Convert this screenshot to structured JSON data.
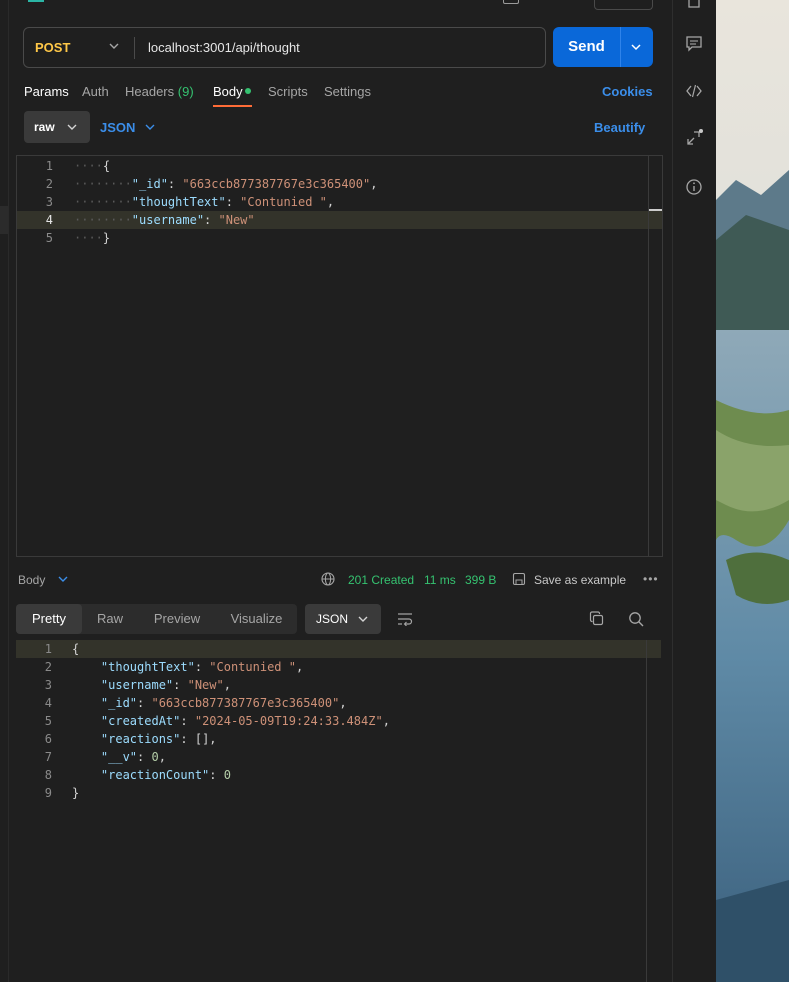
{
  "request": {
    "method": "POST",
    "url": "localhost:3001/api/thought",
    "send_label": "Send"
  },
  "request_tabs": {
    "params": "Params",
    "auth": "Auth",
    "headers": "Headers",
    "headers_count": "(9)",
    "body": "Body",
    "scripts": "Scripts",
    "settings": "Settings",
    "cookies": "Cookies"
  },
  "body_options": {
    "mode": "raw",
    "language": "JSON",
    "beautify": "Beautify"
  },
  "request_body": {
    "lines": [
      {
        "n": "1",
        "ws": "····",
        "text": [
          {
            "t": "{",
            "c": "punc"
          }
        ]
      },
      {
        "n": "2",
        "ws": "········",
        "text": [
          {
            "t": "\"_id\"",
            "c": "key"
          },
          {
            "t": ": ",
            "c": "punc"
          },
          {
            "t": "\"663ccb877387767e3c365400\"",
            "c": "str"
          },
          {
            "t": ",",
            "c": "punc"
          }
        ]
      },
      {
        "n": "3",
        "ws": "········",
        "text": [
          {
            "t": "\"thoughtText\"",
            "c": "key"
          },
          {
            "t": ": ",
            "c": "punc"
          },
          {
            "t": "\"Contunied \"",
            "c": "str"
          },
          {
            "t": ",",
            "c": "punc"
          }
        ]
      },
      {
        "n": "4",
        "ws": "········",
        "text": [
          {
            "t": "\"username\"",
            "c": "key"
          },
          {
            "t": ": ",
            "c": "punc"
          },
          {
            "t": "\"New\"",
            "c": "str"
          }
        ]
      },
      {
        "n": "5",
        "ws": "····",
        "text": [
          {
            "t": "}",
            "c": "punc"
          }
        ]
      }
    ]
  },
  "response_meta": {
    "body_label": "Body",
    "status": "201 Created",
    "time": "11 ms",
    "size": "399 B",
    "save_example": "Save as example",
    "more": "•••"
  },
  "response_tabs": {
    "pretty": "Pretty",
    "raw": "Raw",
    "preview": "Preview",
    "visualize": "Visualize",
    "format": "JSON"
  },
  "response_body": {
    "lines": [
      {
        "n": "1",
        "text": [
          {
            "t": "{",
            "c": "punc"
          }
        ]
      },
      {
        "n": "2",
        "text": [
          {
            "t": "    ",
            "c": "punc"
          },
          {
            "t": "\"thoughtText\"",
            "c": "key"
          },
          {
            "t": ": ",
            "c": "punc"
          },
          {
            "t": "\"Contunied \"",
            "c": "str"
          },
          {
            "t": ",",
            "c": "punc"
          }
        ]
      },
      {
        "n": "3",
        "text": [
          {
            "t": "    ",
            "c": "punc"
          },
          {
            "t": "\"username\"",
            "c": "key"
          },
          {
            "t": ": ",
            "c": "punc"
          },
          {
            "t": "\"New\"",
            "c": "str"
          },
          {
            "t": ",",
            "c": "punc"
          }
        ]
      },
      {
        "n": "4",
        "text": [
          {
            "t": "    ",
            "c": "punc"
          },
          {
            "t": "\"_id\"",
            "c": "key"
          },
          {
            "t": ": ",
            "c": "punc"
          },
          {
            "t": "\"663ccb877387767e3c365400\"",
            "c": "str"
          },
          {
            "t": ",",
            "c": "punc"
          }
        ]
      },
      {
        "n": "5",
        "text": [
          {
            "t": "    ",
            "c": "punc"
          },
          {
            "t": "\"createdAt\"",
            "c": "key"
          },
          {
            "t": ": ",
            "c": "punc"
          },
          {
            "t": "\"2024-05-09T19:24:33.484Z\"",
            "c": "str"
          },
          {
            "t": ",",
            "c": "punc"
          }
        ]
      },
      {
        "n": "6",
        "text": [
          {
            "t": "    ",
            "c": "punc"
          },
          {
            "t": "\"reactions\"",
            "c": "key"
          },
          {
            "t": ": [],",
            "c": "punc"
          }
        ]
      },
      {
        "n": "7",
        "text": [
          {
            "t": "    ",
            "c": "punc"
          },
          {
            "t": "\"__v\"",
            "c": "key"
          },
          {
            "t": ": ",
            "c": "punc"
          },
          {
            "t": "0",
            "c": "num"
          },
          {
            "t": ",",
            "c": "punc"
          }
        ]
      },
      {
        "n": "8",
        "text": [
          {
            "t": "    ",
            "c": "punc"
          },
          {
            "t": "\"reactionCount\"",
            "c": "key"
          },
          {
            "t": ": ",
            "c": "punc"
          },
          {
            "t": "0",
            "c": "num"
          }
        ]
      },
      {
        "n": "9",
        "text": [
          {
            "t": "}",
            "c": "punc"
          }
        ]
      }
    ]
  },
  "sidebar": {
    "icons": [
      "document-icon",
      "comments-icon",
      "code-icon",
      "related-icon",
      "info-icon"
    ]
  },
  "colors": {
    "accent_send": "#0a68d9",
    "method_post": "#ffc848",
    "status_ok": "#35c270",
    "link": "#3b8eea",
    "active_tab_underline": "#ff6c37"
  }
}
